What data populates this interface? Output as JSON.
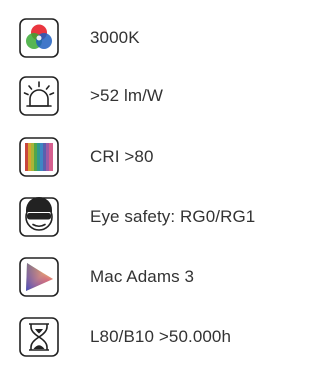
{
  "colors": {
    "text": "#333333",
    "icon_stroke": "#222222",
    "rgb_red": "#e8202a",
    "rgb_green": "#3aa935",
    "rgb_blue": "#1f5fbf"
  },
  "specs": [
    {
      "icon": "rgb-color-icon",
      "label": "3000K"
    },
    {
      "icon": "light-efficacy-icon",
      "label": ">52 lm/W"
    },
    {
      "icon": "color-rendering-icon",
      "label": "CRI >80"
    },
    {
      "icon": "eye-safety-icon",
      "label": "Eye safety: RG0/RG1"
    },
    {
      "icon": "color-gamut-icon",
      "label": "Mac Adams 3"
    },
    {
      "icon": "hourglass-icon",
      "label": "L80/B10 >50.000h"
    }
  ]
}
